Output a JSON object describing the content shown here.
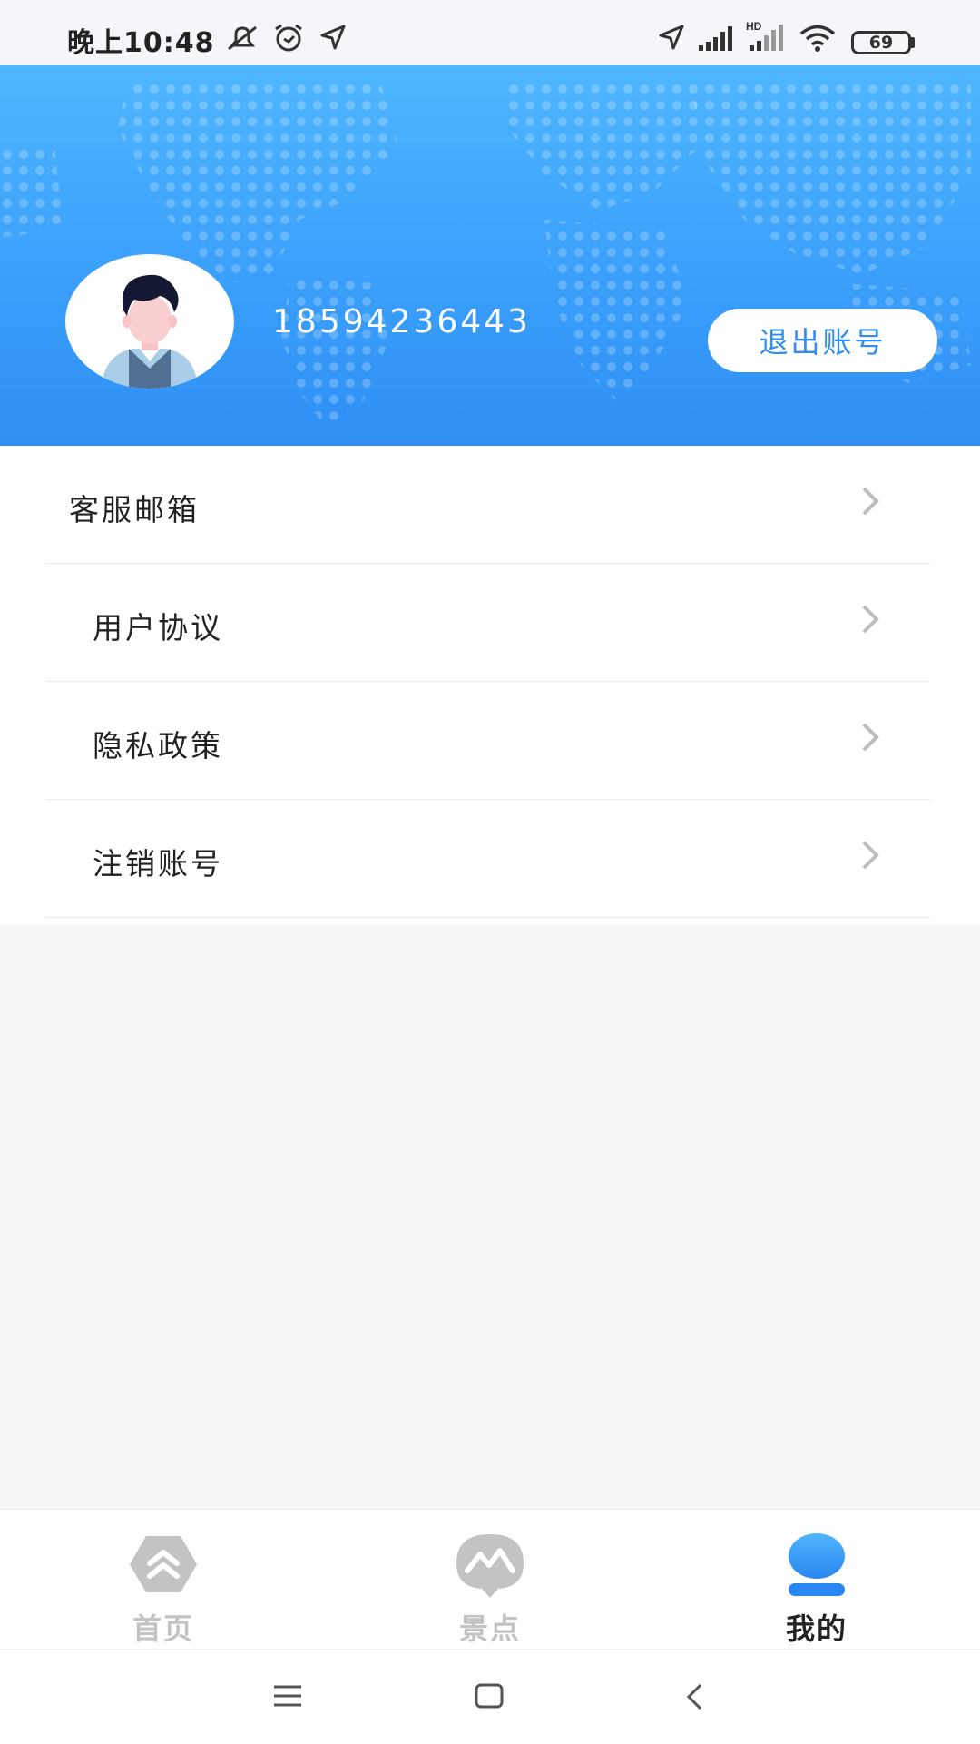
{
  "status_bar": {
    "time": "晚上10:48",
    "battery": "69",
    "icons": [
      "mute-icon",
      "alarm-icon",
      "location-icon",
      "signal-icon",
      "hd-signal-icon",
      "wifi-icon",
      "battery-icon"
    ]
  },
  "header": {
    "phone": "18594236443",
    "logout_label": "退出账号"
  },
  "menu": {
    "items": [
      {
        "label": "客服邮箱"
      },
      {
        "label": "用户协议"
      },
      {
        "label": "隐私政策"
      },
      {
        "label": "注销账号"
      }
    ]
  },
  "tabs": [
    {
      "label": "首页",
      "icon": "home-icon",
      "active": false
    },
    {
      "label": "景点",
      "icon": "scenic-icon",
      "active": false
    },
    {
      "label": "我的",
      "icon": "profile-icon",
      "active": true
    }
  ],
  "nav": {
    "buttons": [
      "menu-icon",
      "home-square-icon",
      "back-icon"
    ]
  },
  "colors": {
    "accent": "#2e8ef2",
    "header_top": "#4fb6ff",
    "header_bottom": "#2f8ff4",
    "tab_inactive": "#c3c3c3",
    "tab_active": "#222222"
  }
}
